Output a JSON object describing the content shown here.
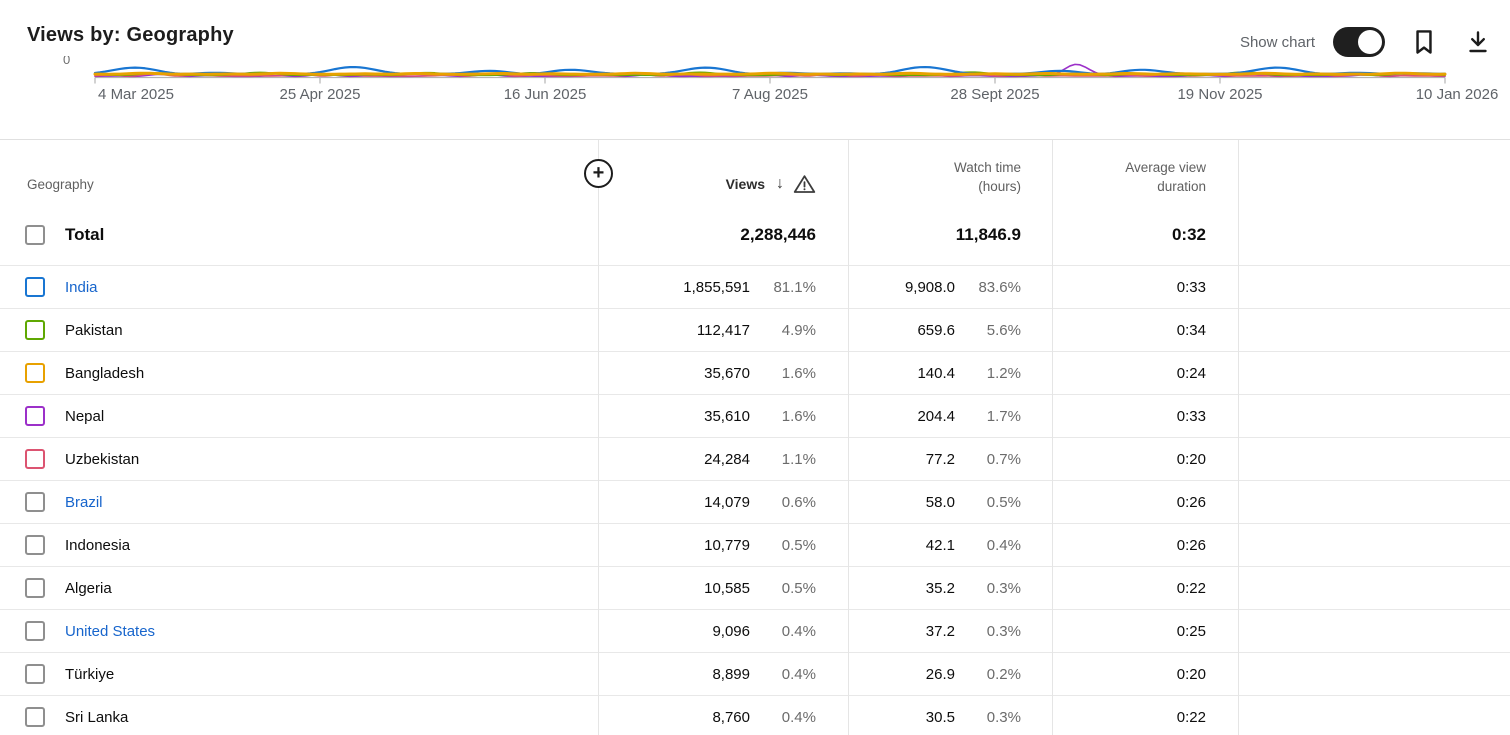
{
  "header": {
    "title": "Views by: Geography",
    "show_chart_label": "Show chart",
    "show_chart_on": true
  },
  "icons": {
    "add_metric": "+",
    "sort_desc": "↓"
  },
  "chart": {
    "y_axis_label": "0",
    "x_ticks": [
      "4 Mar 2025",
      "25 Apr 2025",
      "16 Jun 2025",
      "7 Aug 2025",
      "28 Sept 2025",
      "19 Nov 2025",
      "10 Jan 2026"
    ],
    "series": [
      {
        "name": "Nepal",
        "color": "#9c30c9"
      },
      {
        "name": "Uzbekistan",
        "color": "#dc5471"
      },
      {
        "name": "Pakistan",
        "color": "#5fa802"
      },
      {
        "name": "India",
        "color": "#1976d2"
      },
      {
        "name": "Bangladesh",
        "color": "#e8a100"
      }
    ]
  },
  "table": {
    "columns": {
      "geography": "Geography",
      "views": "Views",
      "watch_line1": "Watch time",
      "watch_line2": "(hours)",
      "avg_line1": "Average view",
      "avg_line2": "duration"
    },
    "total": {
      "label": "Total",
      "views": "2,288,446",
      "watch": "11,846.9",
      "avg": "0:32"
    },
    "rows": [
      {
        "label": "India",
        "link": true,
        "color": "#1976d2",
        "views": "1,855,591",
        "views_pct": "81.1%",
        "watch": "9,908.0",
        "watch_pct": "83.6%",
        "avg": "0:33"
      },
      {
        "label": "Pakistan",
        "link": false,
        "color": "#5fa802",
        "views": "112,417",
        "views_pct": "4.9%",
        "watch": "659.6",
        "watch_pct": "5.6%",
        "avg": "0:34"
      },
      {
        "label": "Bangladesh",
        "link": false,
        "color": "#e8a100",
        "views": "35,670",
        "views_pct": "1.6%",
        "watch": "140.4",
        "watch_pct": "1.2%",
        "avg": "0:24"
      },
      {
        "label": "Nepal",
        "link": false,
        "color": "#9c30c9",
        "views": "35,610",
        "views_pct": "1.6%",
        "watch": "204.4",
        "watch_pct": "1.7%",
        "avg": "0:33"
      },
      {
        "label": "Uzbekistan",
        "link": false,
        "color": "#dc5471",
        "views": "24,284",
        "views_pct": "1.1%",
        "watch": "77.2",
        "watch_pct": "0.7%",
        "avg": "0:20"
      },
      {
        "label": "Brazil",
        "link": true,
        "color": null,
        "views": "14,079",
        "views_pct": "0.6%",
        "watch": "58.0",
        "watch_pct": "0.5%",
        "avg": "0:26"
      },
      {
        "label": "Indonesia",
        "link": false,
        "color": null,
        "views": "10,779",
        "views_pct": "0.5%",
        "watch": "42.1",
        "watch_pct": "0.4%",
        "avg": "0:26"
      },
      {
        "label": "Algeria",
        "link": false,
        "color": null,
        "views": "10,585",
        "views_pct": "0.5%",
        "watch": "35.2",
        "watch_pct": "0.3%",
        "avg": "0:22"
      },
      {
        "label": "United States",
        "link": true,
        "color": null,
        "views": "9,096",
        "views_pct": "0.4%",
        "watch": "37.2",
        "watch_pct": "0.3%",
        "avg": "0:25"
      },
      {
        "label": "Türkiye",
        "link": false,
        "color": null,
        "views": "8,899",
        "views_pct": "0.4%",
        "watch": "26.9",
        "watch_pct": "0.2%",
        "avg": "0:20"
      },
      {
        "label": "Sri Lanka",
        "link": false,
        "color": null,
        "views": "8,760",
        "views_pct": "0.4%",
        "watch": "30.5",
        "watch_pct": "0.3%",
        "avg": "0:22"
      }
    ]
  }
}
